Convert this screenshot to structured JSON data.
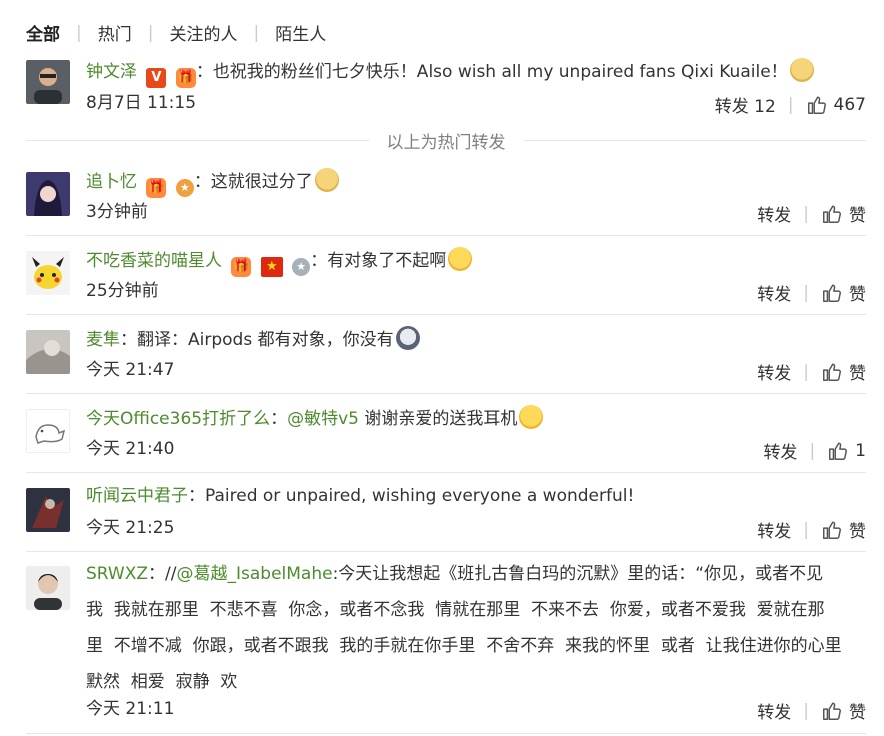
{
  "tabs": [
    "全部",
    "热门",
    "关注的人",
    "陌生人"
  ],
  "hot_separator": "以上为热门转发",
  "actions": {
    "repost": "转发",
    "like": "赞"
  },
  "comments": [
    {
      "user": "钟文泽",
      "text": "：也祝我的粉丝们七夕快乐！Also wish all my unpaired fans Qixi Kuaile！",
      "time": "8月7日 11:15",
      "repost_count": "12",
      "like_count": "467",
      "badges": [
        "V",
        "gift"
      ],
      "emoji": "dog"
    },
    {
      "user": "追卜忆",
      "text": "：这就很过分了",
      "time": "3分钟前",
      "badges": [
        "gift",
        "medal"
      ],
      "emoji": "dog"
    },
    {
      "user": "不吃香菜的喵星人",
      "text": "：有对象了不起啊",
      "time": "25分钟前",
      "badges": [
        "gift",
        "flag",
        "medal-silver"
      ],
      "emoji": "cry"
    },
    {
      "user": "麦隼",
      "text": "：翻译：Airpods 都有对象，你没有",
      "time": "今天 21:47",
      "emoji": "husky"
    },
    {
      "user": "今天Office365打折了么",
      "text_prefix": "：",
      "mention": "@敏特v5",
      "text": " 谢谢亲爱的送我耳机",
      "time": "今天 21:40",
      "like_count": "1",
      "emoji": "kiss"
    },
    {
      "user": "听闻云中君子",
      "text": "：Paired or unpaired, wishing everyone a wonderful!",
      "time": "今天 21:25"
    },
    {
      "user": "SRWXZ",
      "text_prefix": "：//",
      "mention": "@葛越_IsabelMahe",
      "text_line1": ":今天让我想起《班扎古鲁白玛的沉默》里的话：“你见，或者不见",
      "text_line2": "我  我就在那里  不悲不喜  你念，或者不念我  情就在那里  不来不去  你爱，或者不爱我  爱就在那",
      "text_line3": "里  不增不减  你跟，或者不跟我  我的手就在你手里  不舍不弃  来我的怀里  或者  让我住进你的心里",
      "text_line4": "默然  相爱  寂静  欢",
      "time": "今天 21:11"
    }
  ]
}
